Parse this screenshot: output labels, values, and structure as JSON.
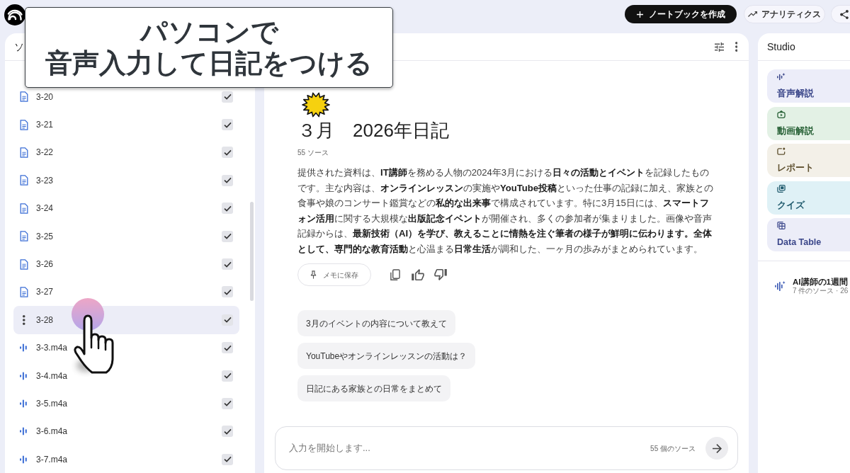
{
  "app": {
    "create_button": "ノートブックを作成",
    "analytics_button": "アナリティクス"
  },
  "caption": {
    "lines": [
      "パソコンで",
      "音声入力して日記をつける"
    ]
  },
  "sources_panel": {
    "title": "ソ",
    "items": [
      {
        "label": "3-20",
        "kind": "doc",
        "hovered": false,
        "checked": true
      },
      {
        "label": "3-21",
        "kind": "doc",
        "hovered": false,
        "checked": true
      },
      {
        "label": "3-22",
        "kind": "doc",
        "hovered": false,
        "checked": true
      },
      {
        "label": "3-23",
        "kind": "doc",
        "hovered": false,
        "checked": true
      },
      {
        "label": "3-24",
        "kind": "doc",
        "hovered": false,
        "checked": true
      },
      {
        "label": "3-25",
        "kind": "doc",
        "hovered": false,
        "checked": true
      },
      {
        "label": "3-26",
        "kind": "doc",
        "hovered": false,
        "checked": true
      },
      {
        "label": "3-27",
        "kind": "doc",
        "hovered": false,
        "checked": true
      },
      {
        "label": "3-28",
        "kind": "doc",
        "hovered": true,
        "checked": true
      },
      {
        "label": "3-3.m4a",
        "kind": "audio",
        "hovered": false,
        "checked": true
      },
      {
        "label": "3-4.m4a",
        "kind": "audio",
        "hovered": false,
        "checked": true
      },
      {
        "label": "3-5.m4a",
        "kind": "audio",
        "hovered": false,
        "checked": true
      },
      {
        "label": "3-6.m4a",
        "kind": "audio",
        "hovered": false,
        "checked": true
      },
      {
        "label": "3-7.m4a",
        "kind": "audio",
        "hovered": false,
        "checked": true
      }
    ]
  },
  "chat_panel": {
    "title": "３月　2026年日記",
    "source_count": "55 ソース",
    "summary": "提供された資料は、**IT講師**を務める人物の2024年3月における**日々の活動とイベント**を記録したものです。主な内容は、**オンラインレッスン**の実施や**YouTube投稿**といった仕事の記録に加え、家族との食事や娘のコンサート鑑賞などの**私的な出来事**で構成されています。特に3月15日には、**スマートフォン活用**に関する大規模な**出版記念イベント**が開催され、多くの参加者が集まりました。画像や音声記録からは、**最新技術（AI）を学び、教えることに情熱を注ぐ筆者の様子が鮮明に伝わります。全体として、専門的な教育活動**と心温まる**日常生活**が調和した、一ヶ月の歩みがまとめられています。",
    "save_button": "メモに保存",
    "suggestions": [
      "3月のイベントの内容について教えて",
      "YouTubeやオンラインレッスンの活動は？",
      "日記にある家族との日常をまとめて"
    ],
    "input": {
      "placeholder": "入力を開始します...",
      "source_count": "55 個のソース"
    }
  },
  "studio_panel": {
    "title": "Studio",
    "cards": [
      {
        "label": "音声解説",
        "kind": "audio",
        "color": "#ecedf9"
      },
      {
        "label": "動画解説",
        "kind": "video",
        "color": "#e3f1e5"
      },
      {
        "label": "レポート",
        "kind": "report",
        "color": "#f3f0e8"
      },
      {
        "label": "クイズ",
        "kind": "quiz",
        "color": "#dff1f6"
      },
      {
        "label": "Data Table",
        "kind": "table",
        "color": "#ecedf8"
      }
    ],
    "notes": [
      {
        "title": "AI講師の1週間",
        "meta": "7 件のソース · 26"
      }
    ]
  }
}
